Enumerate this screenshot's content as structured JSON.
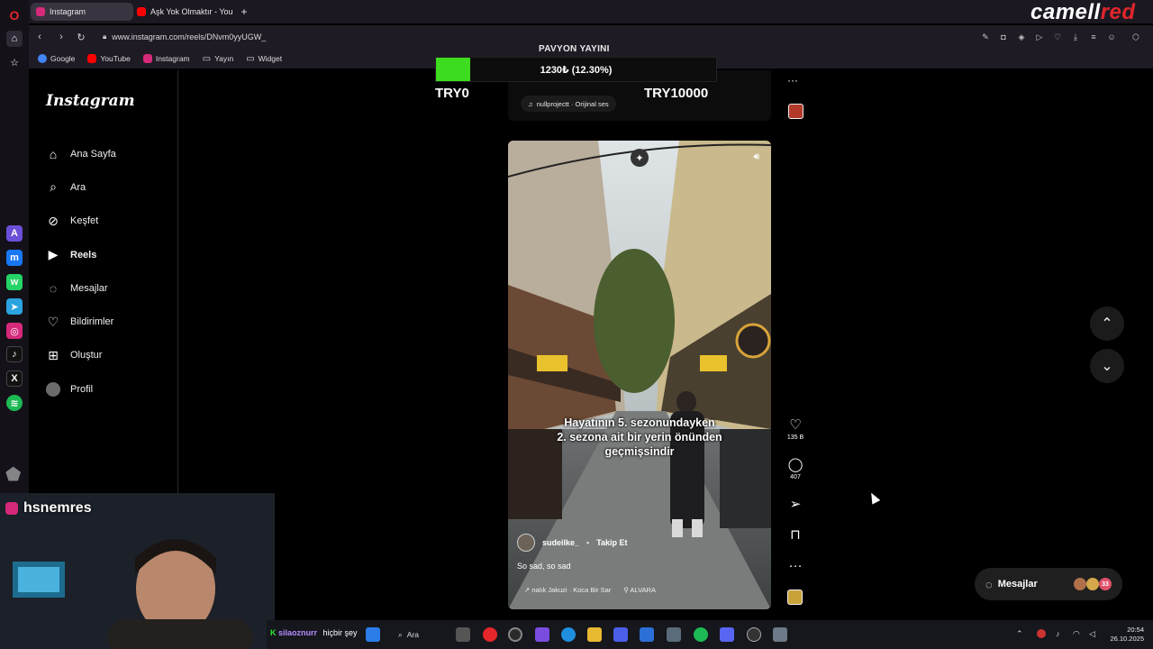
{
  "browser": {
    "tabs": [
      {
        "label": "Instagram",
        "active": true
      },
      {
        "label": "Aşk Yok Olmaktır - YouTub",
        "active": false
      }
    ],
    "new_tab_icon": "plus-icon",
    "url": "www.instagram.com/reels/DNvm0yyUGW_",
    "bookmarks": [
      "Google",
      "YouTube",
      "Instagram",
      "Yayın",
      "Widget"
    ]
  },
  "instagram": {
    "logo": "Instagram",
    "nav": [
      {
        "label": "Ana Sayfa",
        "icon": "home-icon"
      },
      {
        "label": "Ara",
        "icon": "search-icon"
      },
      {
        "label": "Keşfet",
        "icon": "compass-icon"
      },
      {
        "label": "Reels",
        "icon": "reels-icon",
        "active": true
      },
      {
        "label": "Mesajlar",
        "icon": "messenger-icon"
      },
      {
        "label": "Bildirimler",
        "icon": "heart-icon"
      },
      {
        "label": "Oluştur",
        "icon": "plus-square-icon"
      },
      {
        "label": "Profil",
        "icon": "avatar"
      }
    ],
    "prev_reel": {
      "audio": "nullprojectt · Orijinal ses"
    },
    "reel": {
      "caption_lines": [
        "Hayatının 5. sezonundayken",
        "2. sezona ait bir yerin önünden",
        "geçmişsindir"
      ],
      "author": "sudeilke_",
      "follow": "Takip Et",
      "description": "So sad, so sad",
      "audio": "↗ nalık  Jakuzi · Koca Bir Sar",
      "location": "ALVARA"
    },
    "actions": {
      "likes": "135 B",
      "comments": "407"
    },
    "messages_pill": "Mesajlar",
    "messages_badge": "33"
  },
  "overlay": {
    "brand_a": "camell",
    "brand_b": "red",
    "goal_title": "PAVYON YAYINI",
    "goal_text": "1230₺ (12.30%)",
    "goal_fraction": 0.123,
    "goal_min": "TRY0",
    "goal_max": "TRY10000",
    "handle": "hsnemres"
  },
  "taskbar": {
    "chat_user": "silaoznurr",
    "chat_text": "hiçbir şey",
    "search": "Ara",
    "time": "20:54",
    "date": "26.10.2025"
  },
  "colors": {
    "accent_green": "#3ddc1f",
    "brand_red": "#e0262b"
  }
}
